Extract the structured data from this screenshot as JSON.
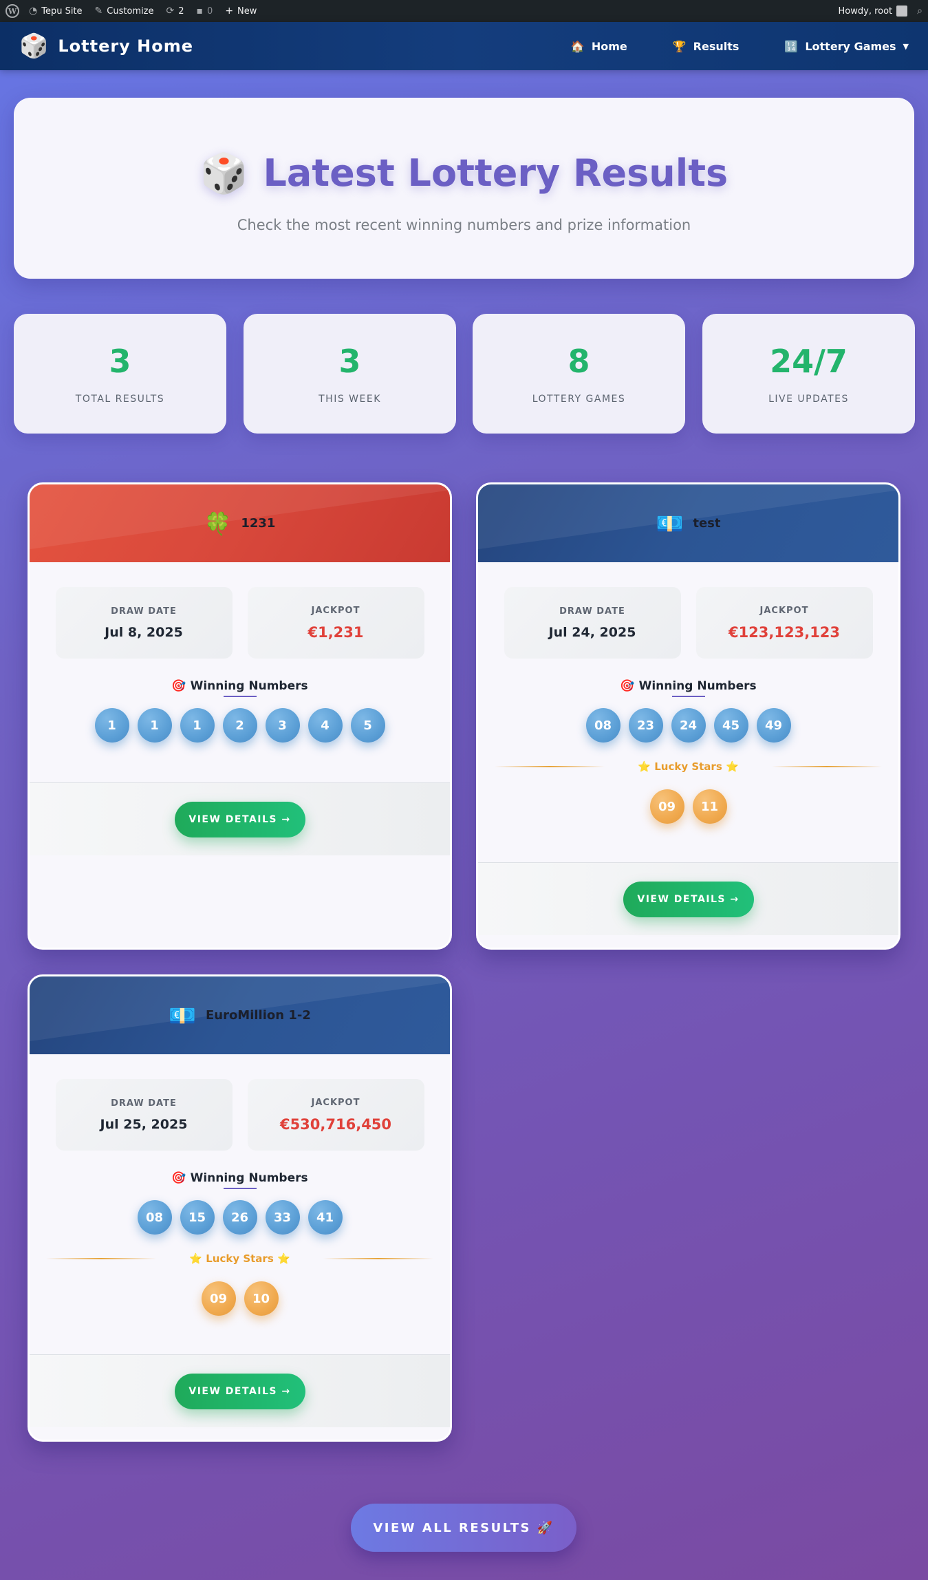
{
  "adminbar": {
    "wp_logo": "W",
    "site_name": "Tepu Site",
    "customize": "Customize",
    "updates_count": "2",
    "comments_count": "0",
    "new_label": "New",
    "howdy": "Howdy, root"
  },
  "header": {
    "brand": "Lottery Home",
    "nav": [
      {
        "icon": "🏠",
        "label": "Home"
      },
      {
        "icon": "🏆",
        "label": "Results"
      },
      {
        "icon": "🔢",
        "label": "Lottery Games"
      }
    ]
  },
  "hero": {
    "icon": "🎲",
    "title": "Latest Lottery Results",
    "subtitle": "Check the most recent winning numbers and prize information"
  },
  "stats": [
    {
      "value": "3",
      "label": "TOTAL RESULTS"
    },
    {
      "value": "3",
      "label": "THIS WEEK"
    },
    {
      "value": "8",
      "label": "LOTTERY GAMES"
    },
    {
      "value": "24/7",
      "label": "LIVE UPDATES"
    }
  ],
  "labels": {
    "draw_date": "DRAW DATE",
    "jackpot": "JACKPOT",
    "winning_numbers": "Winning Numbers",
    "winning_icon": "🎯",
    "lucky_stars": "⭐ Lucky Stars ⭐",
    "view_details": "VIEW DETAILS →"
  },
  "results": [
    {
      "icon": "🍀",
      "name": "1231",
      "header_color": "red",
      "draw_date": "Jul 8, 2025",
      "jackpot": "€1,231",
      "numbers": [
        "1",
        "1",
        "1",
        "2",
        "3",
        "4",
        "5"
      ],
      "stars": []
    },
    {
      "icon": "💶",
      "name": "test",
      "header_color": "blue",
      "draw_date": "Jul 24, 2025",
      "jackpot": "€123,123,123",
      "numbers": [
        "08",
        "23",
        "24",
        "45",
        "49"
      ],
      "stars": [
        "09",
        "11"
      ]
    },
    {
      "icon": "💶",
      "name": "EuroMillion 1-2",
      "header_color": "blue",
      "draw_date": "Jul 25, 2025",
      "jackpot": "€530,716,450",
      "numbers": [
        "08",
        "15",
        "26",
        "33",
        "41"
      ],
      "stars": [
        "09",
        "10"
      ]
    }
  ],
  "view_all": "VIEW ALL RESULTS 🚀"
}
